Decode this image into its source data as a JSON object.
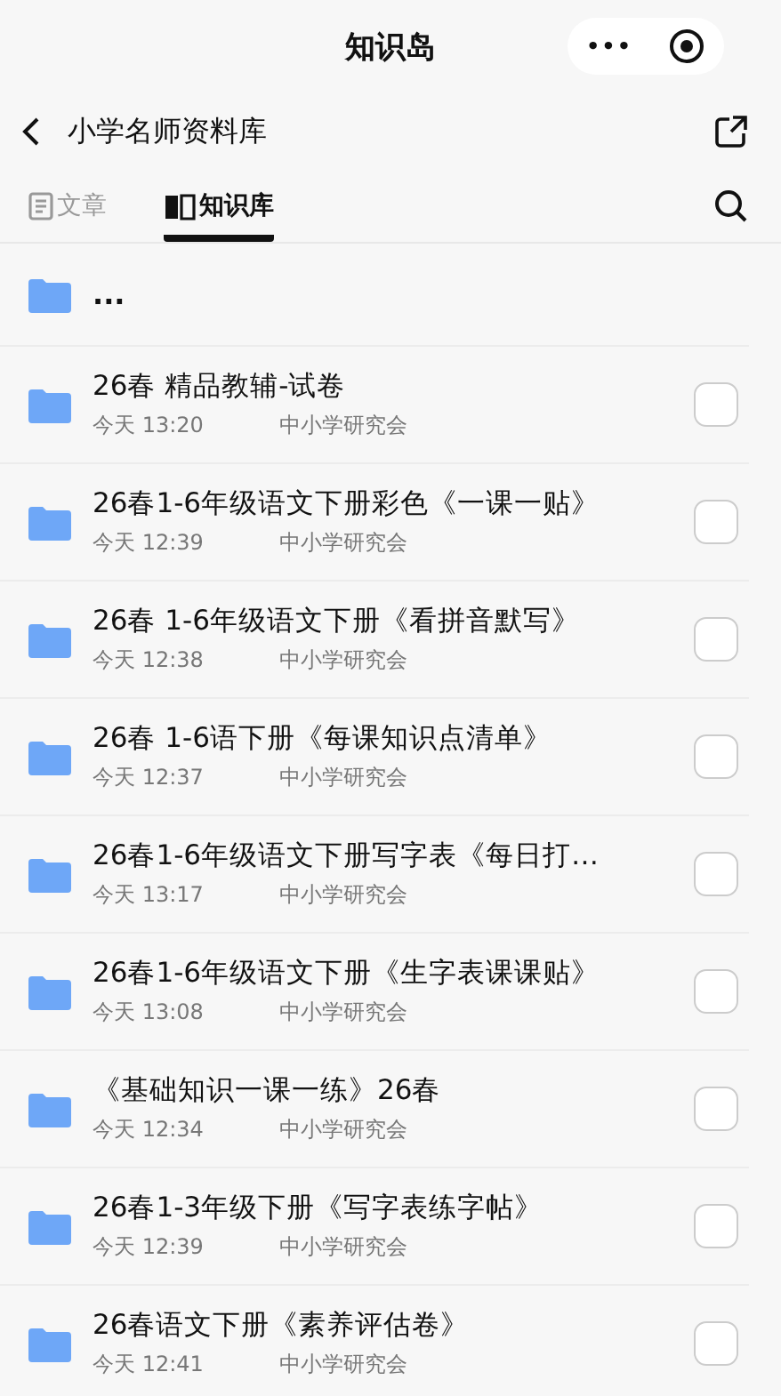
{
  "window": {
    "title": "知识岛"
  },
  "capsule": {
    "more": "•••"
  },
  "nav": {
    "title": "小学名师资料库"
  },
  "tabs": [
    {
      "label": "文章",
      "selected": false,
      "kind": "article"
    },
    {
      "label": "知识库",
      "selected": true,
      "kind": "book"
    }
  ],
  "parent_folder": {
    "name": "..."
  },
  "folders": [
    {
      "name": "26春 精品教辅-试卷",
      "time": "今天 13:20",
      "author": "中小学研究会",
      "checked": false
    },
    {
      "name": "26春1-6年级语文下册彩色《一课一贴》",
      "time": "今天 12:39",
      "author": "中小学研究会",
      "checked": false
    },
    {
      "name": "26春 1-6年级语文下册《看拼音默写》",
      "time": "今天 12:38",
      "author": "中小学研究会",
      "checked": false
    },
    {
      "name": "26春 1-6语下册《每课知识点清单》",
      "time": "今天 12:37",
      "author": "中小学研究会",
      "checked": false
    },
    {
      "name": "26春1-6年级语文下册写字表《每日打…",
      "time": "今天 13:17",
      "author": "中小学研究会",
      "checked": false
    },
    {
      "name": "26春1-6年级语文下册《生字表课课贴》",
      "time": "今天 13:08",
      "author": "中小学研究会",
      "checked": false
    },
    {
      "name": "《基础知识一课一练》26春",
      "time": "今天 12:34",
      "author": "中小学研究会",
      "checked": false
    },
    {
      "name": "26春1-3年级下册《写字表练字帖》",
      "time": "今天 12:39",
      "author": "中小学研究会",
      "checked": false
    },
    {
      "name": "26春语文下册《素养评估卷》",
      "time": "今天 12:41",
      "author": "中小学研究会",
      "checked": false
    }
  ]
}
